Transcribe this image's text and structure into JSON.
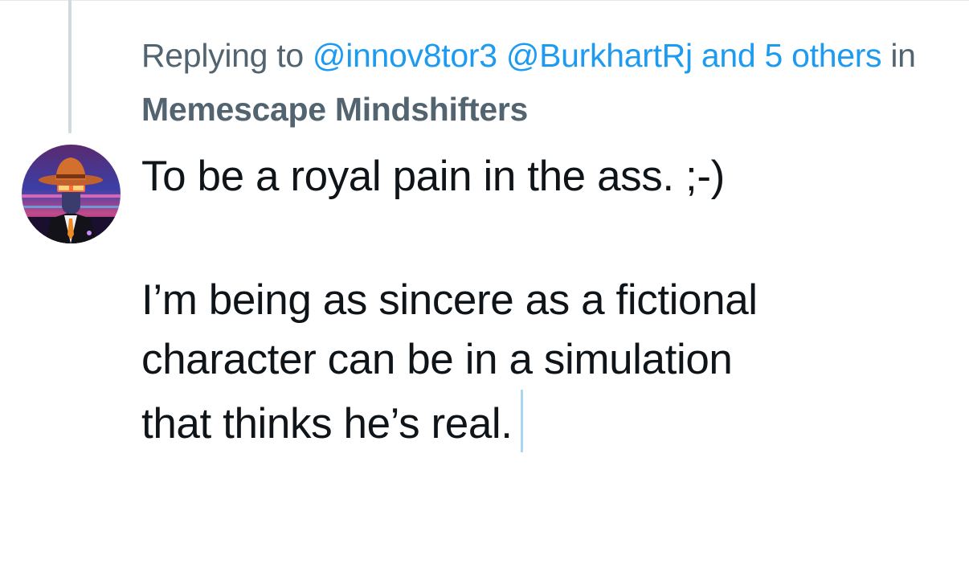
{
  "reply_context": {
    "prefix": "Replying to",
    "mentions": [
      "@innov8tor3",
      "@BurkhartRj"
    ],
    "and_text": "and 5 others",
    "in_text": "in",
    "community": "Memescape Mindshifters"
  },
  "tweet": {
    "paragraph_1": "To be a royal pain in the ass. ;-)",
    "paragraph_2_line_1": "I’m being as sincere as a fictional",
    "paragraph_2_line_2": "character can be in a simulation",
    "paragraph_2_line_3": "that thinks he’s real."
  },
  "colors": {
    "accent": "#1d9bf0",
    "secondary_text": "#536471",
    "primary_text": "#0f1419",
    "thread_line": "#cfd9de"
  }
}
